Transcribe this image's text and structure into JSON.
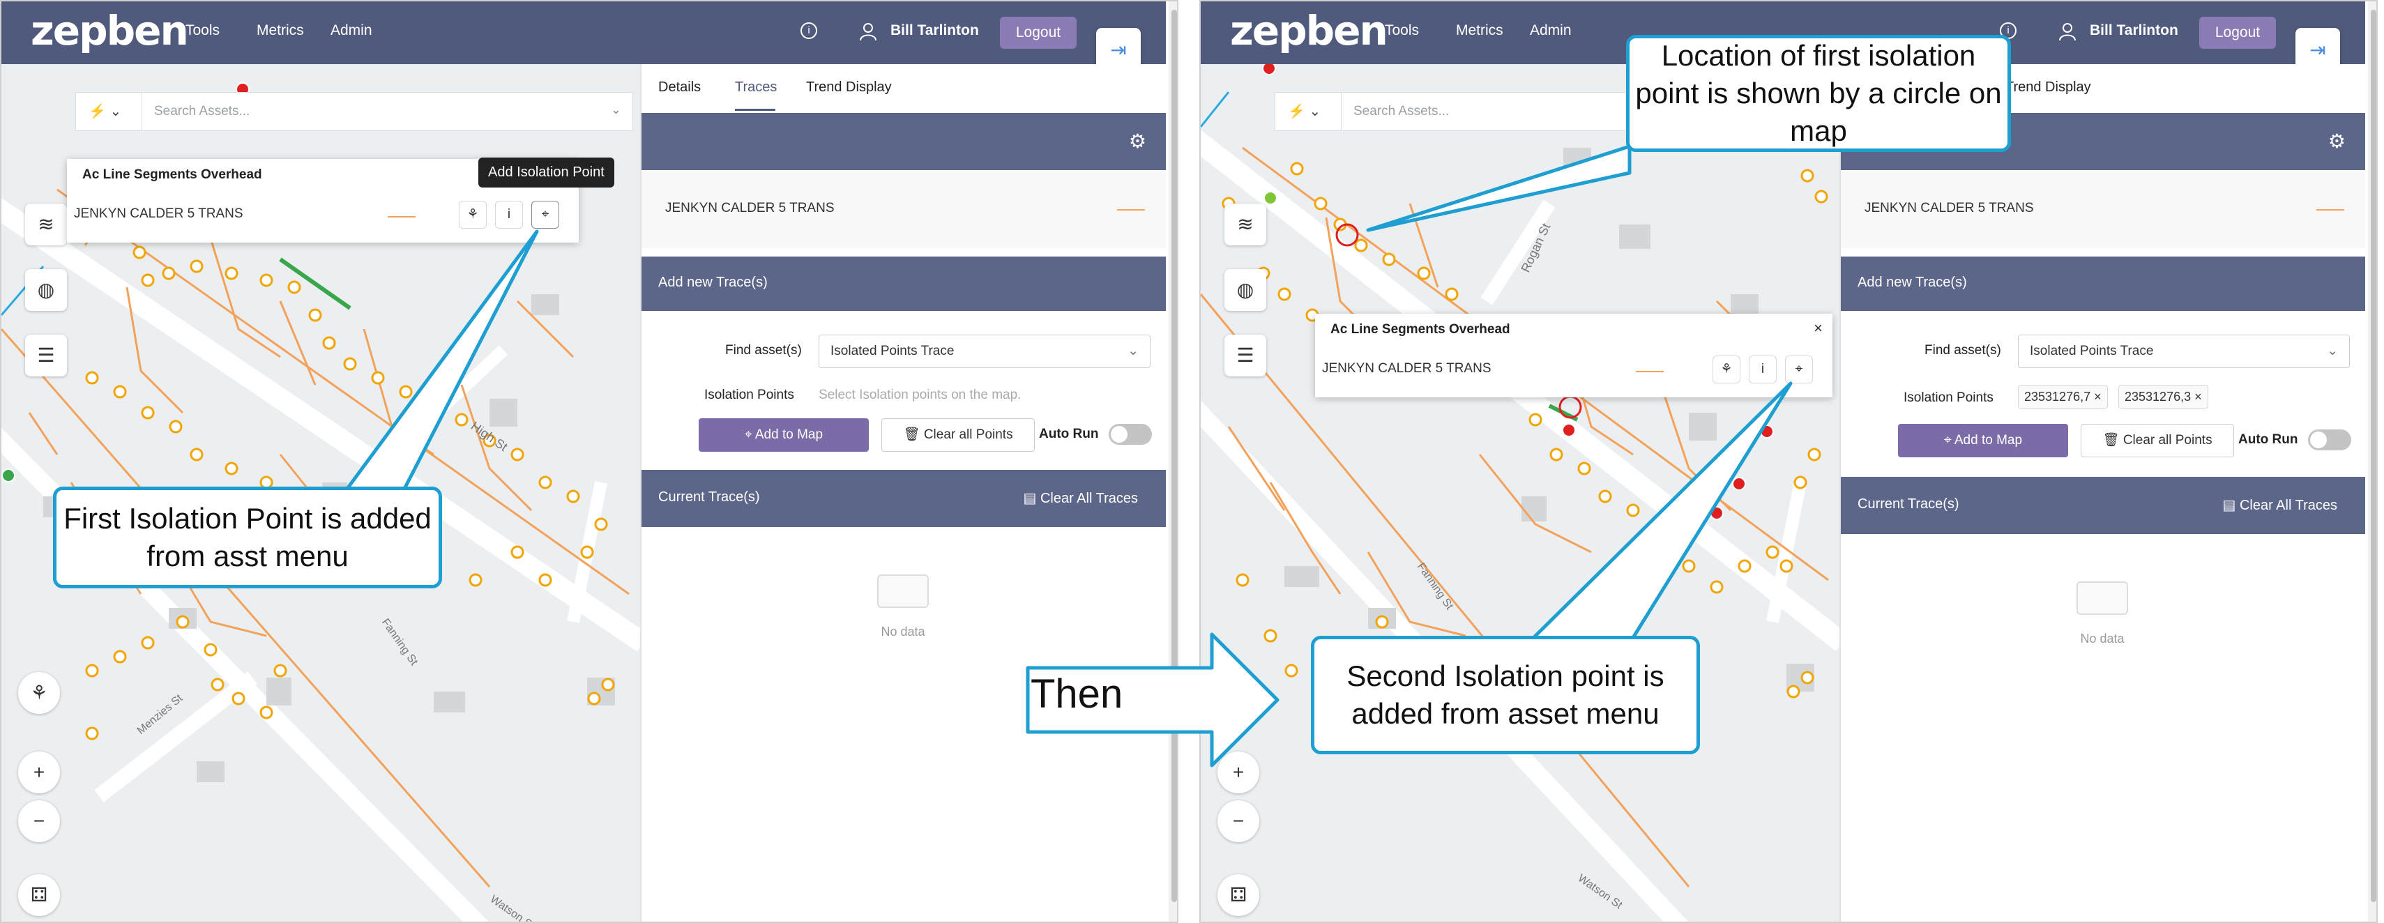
{
  "app": {
    "logo": "zepben",
    "nav": [
      "Tools",
      "Metrics",
      "Admin"
    ],
    "user": "Bill Tarlinton",
    "logout": "Logout"
  },
  "search": {
    "placeholder": "Search Assets..."
  },
  "tabs": [
    "Details",
    "Traces",
    "Trend Display"
  ],
  "popup": {
    "title": "Ac Line Segments Overhead",
    "asset": "JENKYN CALDER 5 TRANS",
    "tooltip": "Add Isolation Point",
    "close": "×"
  },
  "traces": {
    "asset_row": "JENKYN CALDER 5 TRANS",
    "add_new": "Add new Trace(s)",
    "find_label": "Find asset(s)",
    "find_value": "Isolated Points Trace",
    "iso_label": "Isolation Points",
    "iso_placeholder": "Select Isolation points on the map.",
    "iso_tags": [
      "23531276,7",
      "23531276,3"
    ],
    "add_to_map": "Add to Map",
    "clear_points": "Clear all Points",
    "auto_run": "Auto Run",
    "current": "Current Trace(s)",
    "clear_traces": "Clear All Traces",
    "no_data": "No data"
  },
  "map_labels": [
    "High St",
    "Fanning St",
    "Menzies St",
    "Watson St",
    "Rogan St",
    "Fanning St",
    "Watson St"
  ],
  "annotations": {
    "callout1": "First Isolation Point is added from asst menu",
    "callout2": "Location of first isolation point is shown by a circle on map",
    "callout3": "Second Isolation point is added from asset menu",
    "then": "Then"
  },
  "colors": {
    "header": "#505a7c",
    "accent": "#7b6ca8",
    "band": "#5c6689",
    "callout_border": "#1f9fd1",
    "asset_orange": "#f4a259",
    "node_yellow": "#f0a500"
  }
}
